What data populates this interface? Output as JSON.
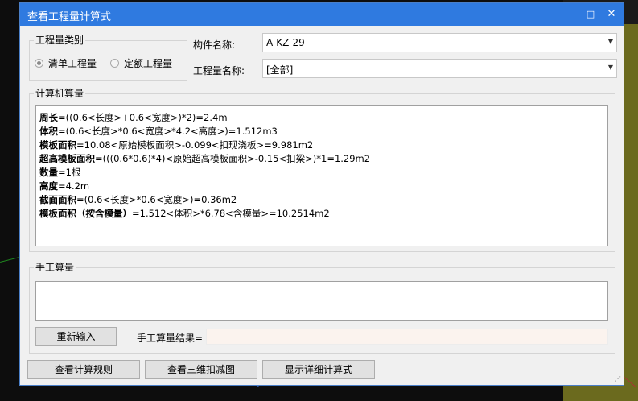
{
  "window": {
    "title": "查看工程量计算式",
    "minimize": "–",
    "maximize": "□",
    "close": "✕"
  },
  "quantity_type": {
    "group_label": "工程量类别",
    "options": [
      {
        "label": "清单工程量",
        "selected": true
      },
      {
        "label": "定额工程量",
        "selected": false
      }
    ]
  },
  "component": {
    "name_label": "构件名称:",
    "name_value": "A-KZ-29",
    "quantity_label": "工程量名称:",
    "quantity_value": "[全部]"
  },
  "computer_calc": {
    "group_label": "计算机算量",
    "lines": [
      {
        "name": "周长",
        "expr": "=((0.6<长度>+0.6<宽度>)*2)=2.4m"
      },
      {
        "name": "体积",
        "expr": "=(0.6<长度>*0.6<宽度>*4.2<高度>)=1.512m3"
      },
      {
        "name": "模板面积",
        "expr": "=10.08<原始模板面积>-0.099<扣现浇板>=9.981m2"
      },
      {
        "name": "超高模板面积",
        "expr": "=(((0.6*0.6)*4)<原始超高模板面积>-0.15<扣梁>)*1=1.29m2"
      },
      {
        "name": "数量",
        "expr": "=1根"
      },
      {
        "name": "高度",
        "expr": "=4.2m"
      },
      {
        "name": "截面面积",
        "expr": "=(0.6<长度>*0.6<宽度>)=0.36m2"
      },
      {
        "name": "模板面积（按含模量）",
        "expr": "=1.512<体积>*6.78<含模量>=10.2514m2"
      }
    ]
  },
  "manual_calc": {
    "group_label": "手工算量",
    "input_value": "",
    "reenter_button": "重新输入",
    "result_label": "手工算量结果=",
    "result_value": ""
  },
  "bottom_buttons": {
    "view_rules": "查看计算规则",
    "view_3d": "查看三维扣减图",
    "show_detail": "显示详细计算式"
  },
  "colors": {
    "titlebar": "#2f7ae0",
    "dialog_bg": "#f0f0f0",
    "result_bg": "#fbf3ee"
  }
}
